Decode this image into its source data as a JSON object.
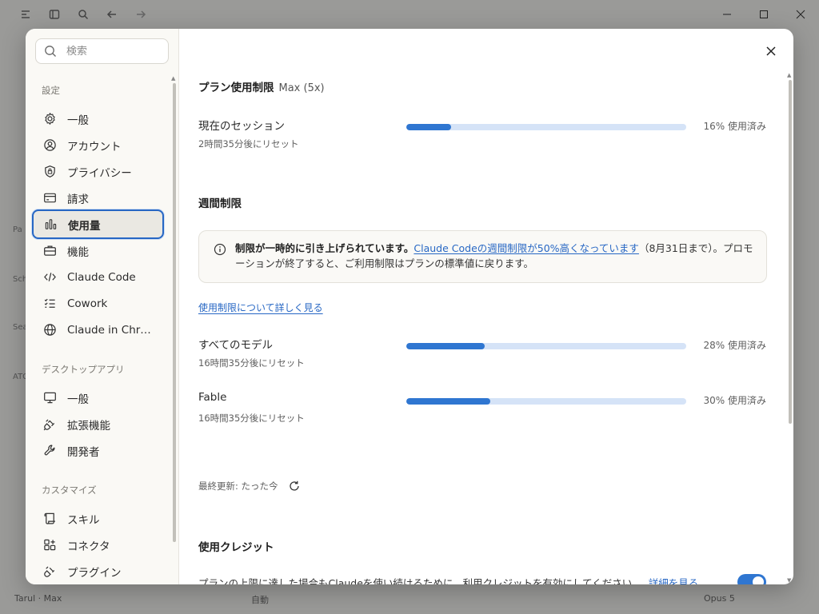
{
  "background": {
    "bottom_user": "Tarul · Max",
    "bottom_mid": "自動",
    "bottom_model": "Opus 5",
    "side_letters": [
      "Pa",
      "Sch",
      "Sea",
      "ATG"
    ]
  },
  "sidebar": {
    "search_placeholder": "検索",
    "section_settings": "設定",
    "settings_items": [
      {
        "label": "一般",
        "icon": "gear-icon"
      },
      {
        "label": "アカウント",
        "icon": "user-circle-icon"
      },
      {
        "label": "プライバシー",
        "icon": "shield-lock-icon"
      },
      {
        "label": "請求",
        "icon": "credit-card-icon"
      },
      {
        "label": "使用量",
        "icon": "bar-chart-icon"
      },
      {
        "label": "機能",
        "icon": "toolbox-icon"
      },
      {
        "label": "Claude Code",
        "icon": "code-icon"
      },
      {
        "label": "Cowork",
        "icon": "checklist-icon"
      },
      {
        "label": "Claude in Chr…",
        "icon": "globe-icon"
      }
    ],
    "section_desktop": "デスクトップアプリ",
    "desktop_items": [
      {
        "label": "一般",
        "icon": "monitor-icon"
      },
      {
        "label": "拡張機能",
        "icon": "plug-icon"
      },
      {
        "label": "開発者",
        "icon": "wrench-icon"
      }
    ],
    "section_customize": "カスタマイズ",
    "customize_items": [
      {
        "label": "スキル",
        "icon": "scroll-icon"
      },
      {
        "label": "コネクタ",
        "icon": "grid-plus-icon"
      },
      {
        "label": "プラグイン",
        "icon": "plug-icon"
      }
    ]
  },
  "content": {
    "plan_heading": "プラン使用制限",
    "plan_tier": "Max (5x)",
    "session": {
      "name": "現在のセッション",
      "reset": "2時間35分後にリセット",
      "percent": 16,
      "pct_label": "16% 使用済み"
    },
    "weekly_heading": "週間制限",
    "notice": {
      "bold": "制限が一時的に引き上げられています。",
      "link": "Claude Codeの週間制限が50%高くなっています",
      "rest": "（8月31日まで）。プロモーションが終了すると、ご利用制限はプランの標準値に戻ります。"
    },
    "learn_more": "使用制限について詳しく見る",
    "all_models": {
      "name": "すべてのモデル",
      "reset": "16時間35分後にリセット",
      "percent": 28,
      "pct_label": "28% 使用済み"
    },
    "fable": {
      "name": "Fable",
      "reset": "16時間35分後にリセット",
      "percent": 30,
      "pct_label": "30% 使用済み"
    },
    "last_updated": "最終更新: たった今",
    "credits_heading": "使用クレジット",
    "credits_desc": "プランの上限に達した場合もClaudeを使い続けるために、利用クレジットを有効にしてください。",
    "credits_link": "詳細を見る",
    "credits_enabled": true
  }
}
